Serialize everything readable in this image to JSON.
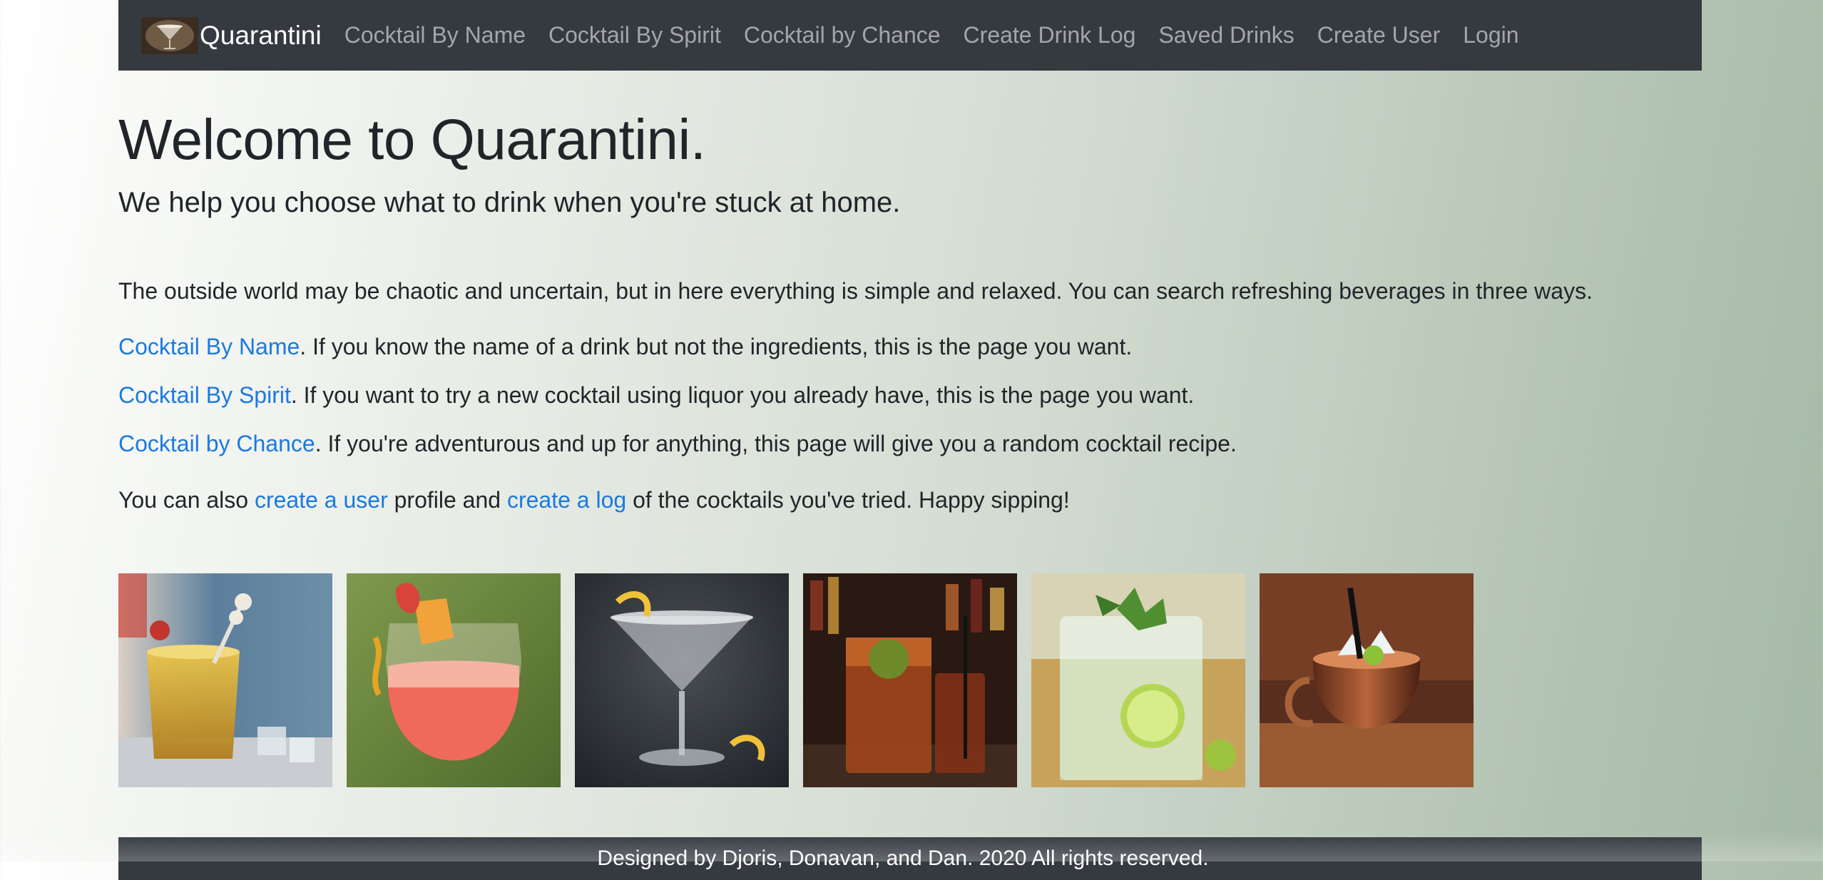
{
  "nav": {
    "brand": "Quarantini",
    "logo_icon": "martini-logo-icon",
    "links": [
      "Cocktail By Name",
      "Cocktail By Spirit",
      "Cocktail by Chance",
      "Create Drink Log",
      "Saved Drinks",
      "Create User",
      "Login"
    ]
  },
  "hero": {
    "title": "Welcome to Quarantini.",
    "subtitle": "We help you choose what to drink when you're stuck at home."
  },
  "content": {
    "intro": "The outside world may be chaotic and uncertain, but in here everything is simple and relaxed. You can search refreshing beverages in three ways.",
    "items": [
      {
        "link": "Cocktail By Name",
        "text": ". If you know the name of a drink but not the ingredients, this is the page you want."
      },
      {
        "link": "Cocktail By Spirit",
        "text": ". If you want to try a new cocktail using liquor you already have, this is the page you want."
      },
      {
        "link": "Cocktail by Chance",
        "text": ". If you're adventurous and up for anything, this page will give you a random cocktail recipe."
      }
    ],
    "outro": {
      "part1": "You can also ",
      "link1": "create a user",
      "part2": " profile and ",
      "link2": "create a log",
      "part3": " of the cocktails you've tried. Happy sipping!"
    }
  },
  "gallery": [
    {
      "icon": "whiskey-sour-photo"
    },
    {
      "icon": "pink-cocktail-photo"
    },
    {
      "icon": "martini-photo"
    },
    {
      "icon": "tall-drink-bar-photo"
    },
    {
      "icon": "mojito-photo"
    },
    {
      "icon": "moscow-mule-photo"
    }
  ],
  "footer": {
    "text": "Designed by Djoris, Donavan, and Dan. 2020 All rights reserved."
  },
  "colors": {
    "navbar": "#343a40",
    "link": "#1b7ae0",
    "nav_link": "#9a9da0",
    "text": "#212529"
  }
}
